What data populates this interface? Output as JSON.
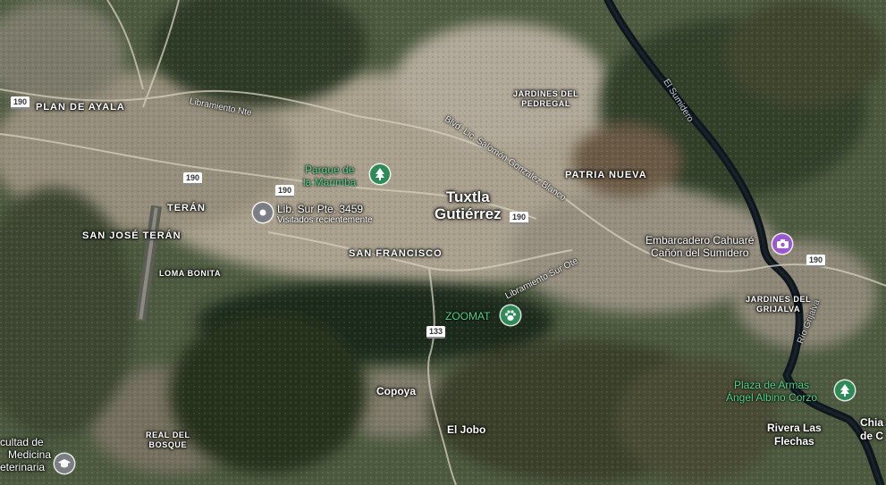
{
  "map": {
    "type": "satellite",
    "colors": {
      "park_green": "#2e8b57",
      "poi_purple": "#9b59d0",
      "school_gray": "#7b7f85",
      "pin_gray": "#7b7f85",
      "poi_label_green": "#4fd18a",
      "river": "#101a22"
    },
    "districts": {
      "plan_de_ayala": "PLAN DE AYALA",
      "teran": "TERÁN",
      "san_jose_teran": "SAN JOSÉ TERÁN",
      "loma_bonita": "LOMA BONITA",
      "san_francisco": "SAN FRANCISCO",
      "jardines_pedregal": [
        "JARDINES DEL",
        "PEDREGAL"
      ],
      "patria_nueva": "PATRIA NUEVA",
      "jardines_grijalva": [
        "JARDINES DEL",
        "GRIJALVA"
      ],
      "real_del_bosque": [
        "REAL DEL",
        "BOSQUE"
      ]
    },
    "city": {
      "name_line1": "Tuxtla",
      "name_line2": "Gutiérrez"
    },
    "places": {
      "copoya": "Copoya",
      "el_jobo": "El Jobo",
      "rivera": [
        "Rivera Las",
        "Flechas"
      ],
      "chia": [
        "Chia",
        "de C"
      ]
    },
    "streets": {
      "lib_norte": "Libramiento Nte",
      "blvd_salomon": "Blvd. Lic. Salomón González Blanco",
      "lib_sur": "Libramiento Sur Ote",
      "el_sumidero": "El Sumidero",
      "rio_grijalva": "Río Grijalva"
    },
    "shields": {
      "s1": "190",
      "s2": "190",
      "s3": "190",
      "s4": "190",
      "s5": "190",
      "s6": "133"
    },
    "pois": {
      "parque_marimba": {
        "line1": "Parque de",
        "line2": "la Marimba",
        "icon": "tree-icon"
      },
      "lib_sur_pte": {
        "title": "Lib. Sur Pte. 3459",
        "subtitle": "Visitados recientemente",
        "icon": "location-pin-icon"
      },
      "zoomat": {
        "label": "ZOOMAT",
        "icon": "paw-icon"
      },
      "embarcadero": {
        "line1": "Embarcadero Cahuaré",
        "line2": "Cañón del Sumidero",
        "icon": "camera-icon"
      },
      "plaza_armas": {
        "line1": "Plaza de Armas",
        "line2": "Ángel Albino Corzo",
        "icon": "tree-icon"
      },
      "facultad": {
        "line1": "cultad de",
        "line2": "Medicina",
        "line3": "eterinaria",
        "icon": "school-icon"
      }
    }
  }
}
